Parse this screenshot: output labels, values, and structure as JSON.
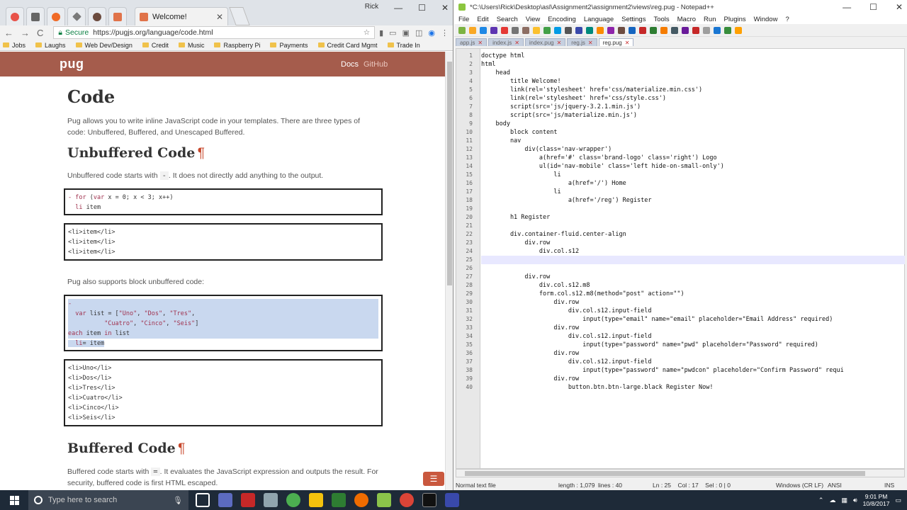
{
  "browser": {
    "active_tab_title": "Welcome!",
    "window_user": "Rick",
    "nav": {
      "back": "←",
      "forward": "→",
      "reload": "C"
    },
    "secure_label": "Secure",
    "url": "https://pugjs.org/language/code.html",
    "bookmarks": [
      "Jobs",
      "Laughs",
      "Web Dev/Design",
      "Credit",
      "Music",
      "Raspberry Pi",
      "Payments",
      "Credit Card Mgmt",
      "Trade In"
    ]
  },
  "pug": {
    "logo": "pug",
    "nav_docs": "Docs",
    "nav_github": "GitHub",
    "h_code": "Code",
    "p_intro": "Pug allows you to write inline JavaScript code in your templates. There are three types of code: Unbuffered, Buffered, and Unescaped Buffered.",
    "h_unbuffered": "Unbuffered Code",
    "pilcrow": "¶",
    "p_unbuffered_1": "Unbuffered code starts with",
    "dash": "-",
    "p_unbuffered_2": ". It does not directly add anything to the output.",
    "code1": [
      "- for (var x = 0; x < 3; x++)",
      "  li item"
    ],
    "out1": [
      "<li>item</li>",
      "<li>item</li>",
      "<li>item</li>"
    ],
    "p_block": "Pug also supports block unbuffered code:",
    "code2": [
      "-",
      "  var list = [\"Uno\", \"Dos\", \"Tres\",",
      "          \"Cuatro\", \"Cinco\", \"Seis\"]",
      "each item in list",
      "  li= item"
    ],
    "out2": [
      "<li>Uno</li>",
      "<li>Dos</li>",
      "<li>Tres</li>",
      "<li>Cuatro</li>",
      "<li>Cinco</li>",
      "<li>Seis</li>"
    ],
    "h_buffered": "Buffered Code",
    "p_buffered_1": "Buffered code starts with",
    "eq": "=",
    "p_buffered_2": ". It evaluates the JavaScript expression and outputs the result. For security, buffered code is first HTML escaped."
  },
  "notepad": {
    "title": "*C:\\Users\\Rick\\Desktop\\asl\\Assignment2\\assignment2\\views\\reg.pug - Notepad++",
    "menu": [
      "File",
      "Edit",
      "Search",
      "View",
      "Encoding",
      "Language",
      "Settings",
      "Tools",
      "Macro",
      "Run",
      "Plugins",
      "Window",
      "?"
    ],
    "tabs": [
      "app.js",
      "index.js",
      "index.pug",
      "reg.js",
      "reg.pug"
    ],
    "lines": [
      "doctype html",
      "html",
      "    head",
      "        title Welcome!",
      "        link(rel='stylesheet' href='css/materialize.min.css')",
      "        link(rel='stylesheet' href='css/style.css')",
      "        script(src='js/jquery-3.2.1.min.js')",
      "        script(src='js/materialize.min.js')",
      "    body",
      "        block content",
      "        nav",
      "            div(class='nav-wrapper')",
      "                a(href='#' class='brand-logo' class='right') Logo",
      "                ul(id='nav-mobile' class='left hide-on-small-only')",
      "                    li",
      "                        a(href='/') Home",
      "                    li",
      "                        a(href='/reg') Register",
      "",
      "        h1 Register",
      "",
      "        div.container-fluid.center-align",
      "            div.row",
      "                div.col.s12",
      "",
      "",
      "            div.row",
      "                div.col.s12.m8",
      "                form.col.s12.m8(method=\"post\" action=\"\")",
      "                    div.row",
      "                        div.col.s12.input-field",
      "                            input(type=\"email\" name=\"email\" placeholder=\"Email Address\" required)",
      "                    div.row",
      "                        div.col.s12.input-field",
      "                            input(type=\"password\" name=\"pwd\" placeholder=\"Password\" required)",
      "                    div.row",
      "                        div.col.s12.input-field",
      "                            input(type=\"password\" name=\"pwdcon\" placeholder=\"Confirm Password\" requi",
      "                    div.row",
      "                        button.btn.btn-large.black Register Now!"
    ],
    "current_line": 25,
    "status": {
      "type": "Normal text file",
      "length": "length : 1,079",
      "lines": "lines : 40",
      "pos": "Ln : 25    Col : 17    Sel : 0 | 0",
      "eol": "Windows (CR LF)",
      "enc": "ANSI",
      "mode": "INS"
    }
  },
  "taskbar": {
    "search_placeholder": "Type here to search",
    "time": "9:01 PM",
    "date": "10/8/2017"
  },
  "colors": {
    "pug_nav": "#a55c4c",
    "accent": "#c7462a",
    "taskbar": "#1e2a38"
  }
}
